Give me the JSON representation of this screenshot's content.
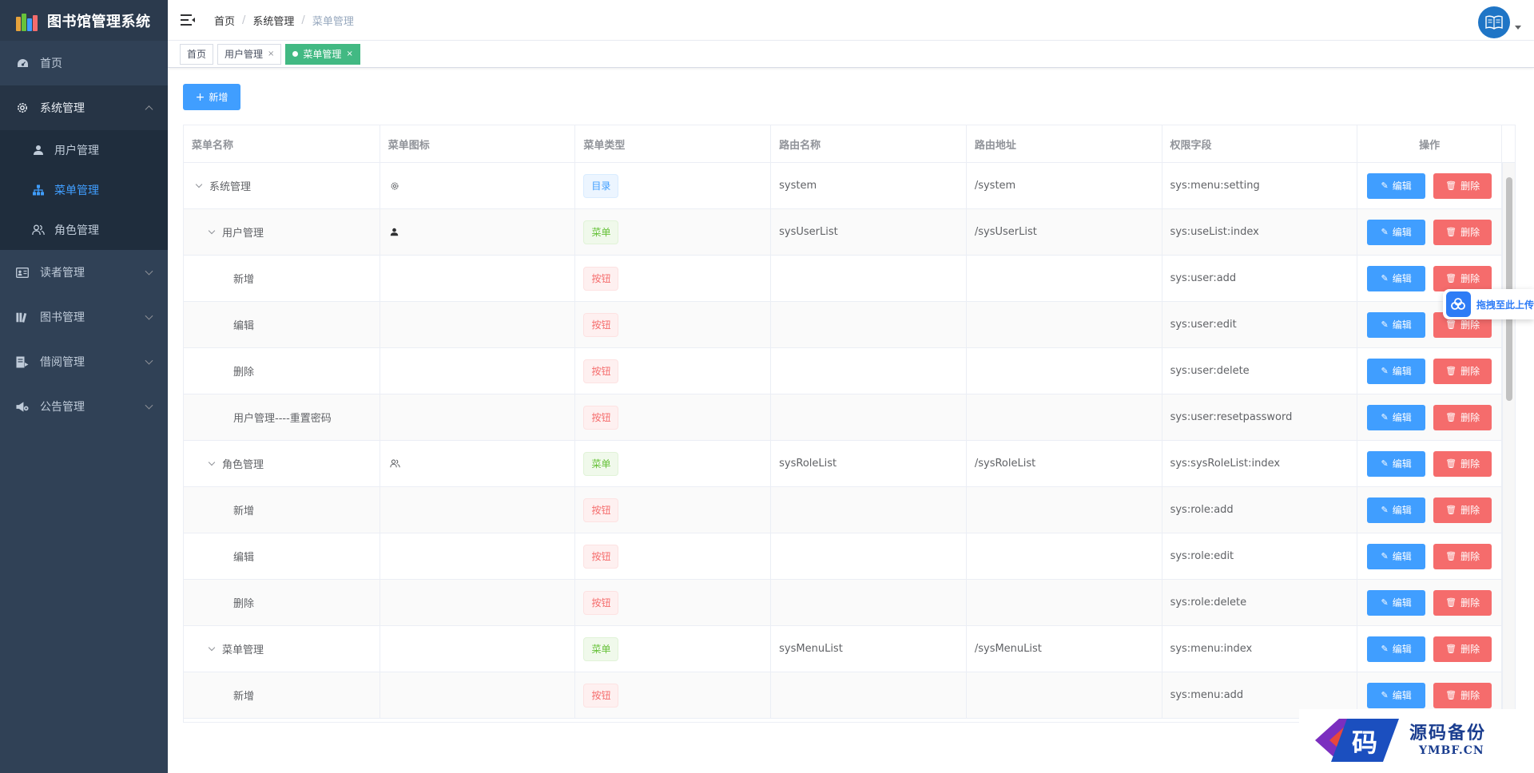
{
  "app": {
    "title": "图书馆管理系统"
  },
  "sidebar": {
    "items": [
      {
        "label": "首页",
        "icon": "dashboard-icon"
      },
      {
        "label": "系统管理",
        "icon": "gear-icon",
        "open": true,
        "children": [
          {
            "label": "用户管理",
            "icon": "user-icon"
          },
          {
            "label": "菜单管理",
            "icon": "tree-icon",
            "active": true
          },
          {
            "label": "角色管理",
            "icon": "users-icon"
          }
        ]
      },
      {
        "label": "读者管理",
        "icon": "id-card-icon"
      },
      {
        "label": "图书管理",
        "icon": "books-icon"
      },
      {
        "label": "借阅管理",
        "icon": "borrow-icon"
      },
      {
        "label": "公告管理",
        "icon": "announce-icon"
      }
    ]
  },
  "breadcrumb": [
    "首页",
    "系统管理",
    "菜单管理"
  ],
  "tags": [
    {
      "label": "首页"
    },
    {
      "label": "用户管理",
      "close": "×"
    },
    {
      "label": "菜单管理",
      "close": "×",
      "active": true
    }
  ],
  "toolbar": {
    "add_label": "新增",
    "add_icon": "+"
  },
  "table": {
    "headers": [
      "菜单名称",
      "菜单图标",
      "菜单类型",
      "路由名称",
      "路由地址",
      "权限字段",
      "操作"
    ],
    "edit_label": "编辑",
    "delete_label": "删除",
    "rows": [
      {
        "name": "系统管理",
        "level": 0,
        "expand": true,
        "icon": "gear-icon",
        "type": "目录",
        "kind": "dir",
        "route_name": "system",
        "route_path": "/system",
        "perm": "sys:menu:setting"
      },
      {
        "name": "用户管理",
        "level": 1,
        "expand": true,
        "icon": "user-icon",
        "type": "菜单",
        "kind": "menu",
        "route_name": "sysUserList",
        "route_path": "/sysUserList",
        "perm": "sys:useList:index"
      },
      {
        "name": "新增",
        "level": 2,
        "type": "按钮",
        "kind": "btn",
        "route_name": "",
        "route_path": "",
        "perm": "sys:user:add"
      },
      {
        "name": "编辑",
        "level": 2,
        "type": "按钮",
        "kind": "btn",
        "route_name": "",
        "route_path": "",
        "perm": "sys:user:edit"
      },
      {
        "name": "删除",
        "level": 2,
        "type": "按钮",
        "kind": "btn",
        "route_name": "",
        "route_path": "",
        "perm": "sys:user:delete"
      },
      {
        "name": "用户管理----重置密码",
        "level": 2,
        "type": "按钮",
        "kind": "btn",
        "route_name": "",
        "route_path": "",
        "perm": "sys:user:resetpassword"
      },
      {
        "name": "角色管理",
        "level": 1,
        "expand": true,
        "icon": "users-icon",
        "type": "菜单",
        "kind": "menu",
        "route_name": "sysRoleList",
        "route_path": "/sysRoleList",
        "perm": "sys:sysRoleList:index"
      },
      {
        "name": "新增",
        "level": 2,
        "type": "按钮",
        "kind": "btn",
        "route_name": "",
        "route_path": "",
        "perm": "sys:role:add"
      },
      {
        "name": "编辑",
        "level": 2,
        "type": "按钮",
        "kind": "btn",
        "route_name": "",
        "route_path": "",
        "perm": "sys:role:edit"
      },
      {
        "name": "删除",
        "level": 2,
        "type": "按钮",
        "kind": "btn",
        "route_name": "",
        "route_path": "",
        "perm": "sys:role:delete"
      },
      {
        "name": "菜单管理",
        "level": 1,
        "expand": true,
        "type": "菜单",
        "kind": "menu",
        "route_name": "sysMenuList",
        "route_path": "/sysMenuList",
        "perm": "sys:menu:index"
      },
      {
        "name": "新增",
        "level": 2,
        "type": "按钮",
        "kind": "btn",
        "route_name": "",
        "route_path": "",
        "perm": "sys:menu:add"
      }
    ]
  },
  "upload_widget": {
    "label": "拖拽至此上传"
  },
  "watermark": {
    "zh": "源码备份",
    "en": "YMBF.CN",
    "glyph": "码"
  },
  "colors": {
    "sidebar_bg": "#304156",
    "primary": "#409eff",
    "danger": "#f56c6c",
    "success": "#67c23a",
    "tag_active": "#42b983"
  }
}
